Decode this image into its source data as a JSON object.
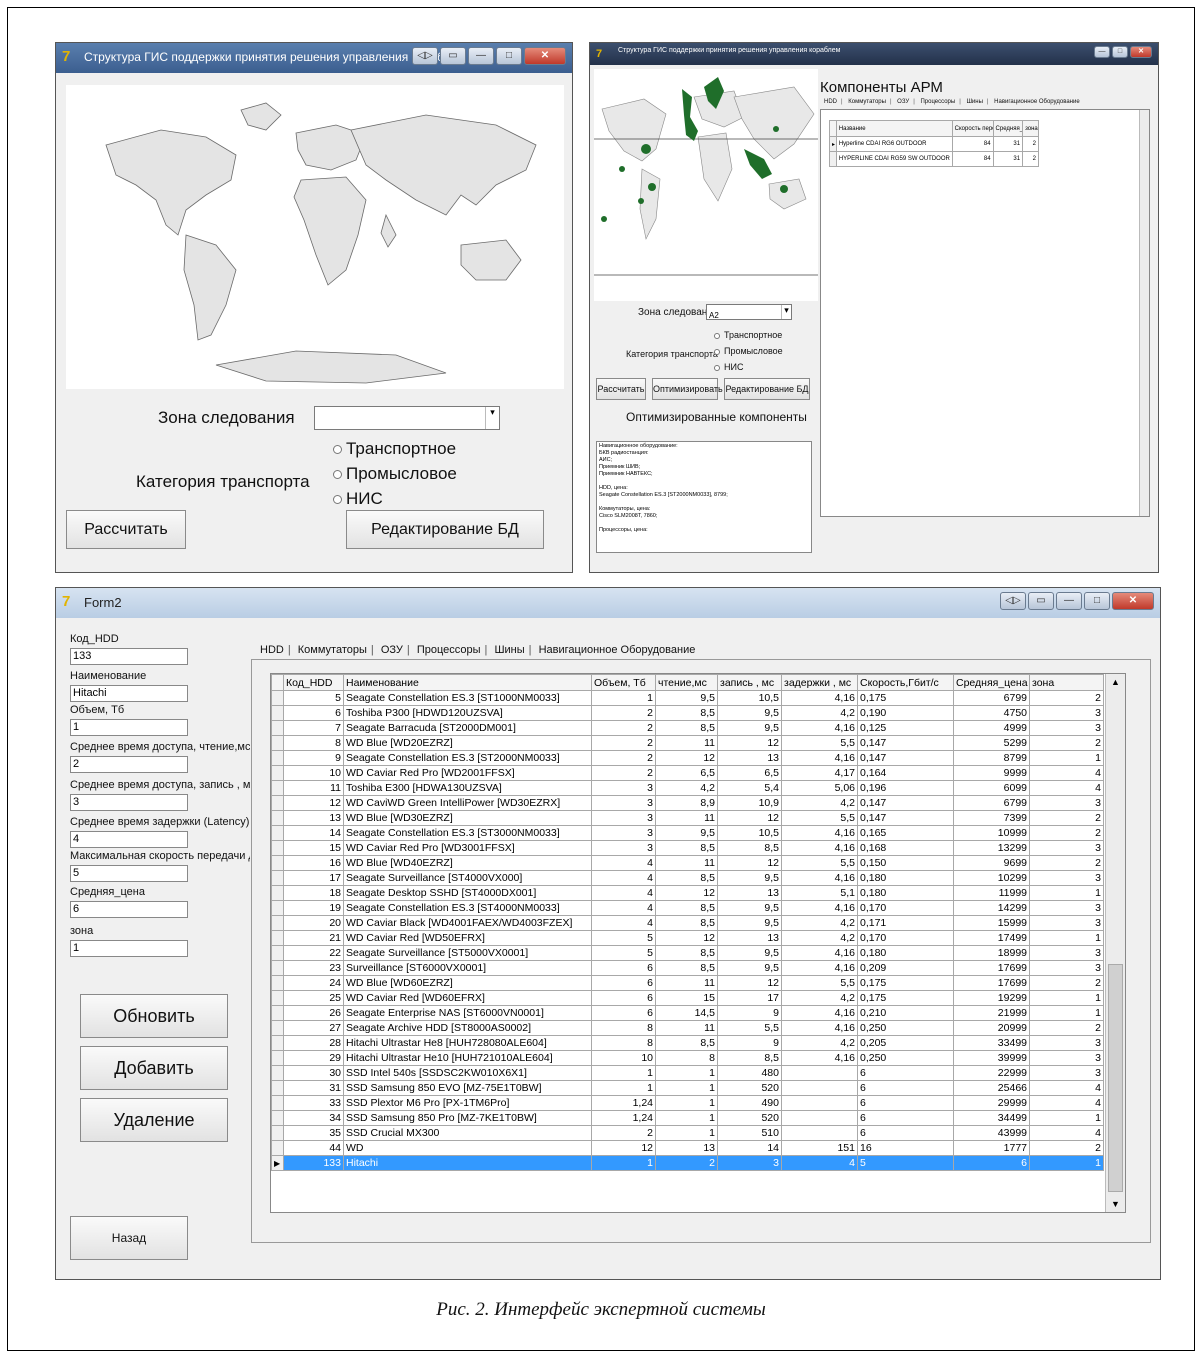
{
  "window1": {
    "title": "Структура ГИС поддержки принятия решения управления кораблем",
    "zone_label": "Зона следования",
    "zone_value": "",
    "category_label": "Категория транспорта",
    "radios": [
      "Транспортное",
      "Промысловое",
      "НИС"
    ],
    "calc_button": "Рассчитать",
    "edit_button": "Редактирование БД"
  },
  "window2": {
    "title": "Структура ГИС поддержки принятия решения управления кораблем",
    "components_title": "Компоненты АРМ",
    "tabs": [
      "HDD",
      "Коммутаторы",
      "ОЗУ",
      "Процессоры",
      "Шины",
      "Навигационное Оборудование"
    ],
    "grid_headers": [
      "Название",
      "Скорость передачи",
      "Средняя_цена",
      "зона"
    ],
    "grid_rows": [
      [
        "Hyperline CDAI RG6 OUTDOOR",
        "84",
        "31",
        "2"
      ],
      [
        "HYPERLINE CDAI RG59 SW OUTDOOR",
        "84",
        "31",
        "2"
      ]
    ],
    "zone_label": "Зона следования",
    "zone_value": "A2",
    "category_label": "Категория транспорта",
    "radios": [
      "Транспортное",
      "Промысловое",
      "НИС"
    ],
    "calc_button": "Рассчитать",
    "optimize_button": "Оптимизировать",
    "edit_button": "Редактирование БД",
    "optimized_title": "Оптимизированные компоненты",
    "optimized_text": [
      "Навигационное оборудование:",
      "БКВ радиостанция:",
      "АИС;",
      "Приемник ШИВ;",
      "Приемник НАВТЕКС;",
      "",
      "HDD, цена:",
      "Seagate Constellation ES.3 [ST2000NM0033], 8799;",
      "",
      "Коммутаторы, цена:",
      "Cisco SLM2008T, 7860;",
      "",
      "Процессоры, цена:"
    ]
  },
  "form2": {
    "title": "Form2",
    "fields": [
      {
        "label": "Код_HDD",
        "value": "133"
      },
      {
        "label": "Наименование",
        "value": "Hitachi"
      },
      {
        "label": "Объем, Тб",
        "value": "1"
      },
      {
        "label": "Среднее время доступа, чтение,мс",
        "value": "2"
      },
      {
        "label": "Среднее время доступа, запись , мс",
        "value": "3"
      },
      {
        "label": "Среднее время задержки (Latency),",
        "value": "4"
      },
      {
        "label": "Максимальная скорость передачи д",
        "value": "5"
      },
      {
        "label": "Средняя_цена",
        "value": "6"
      },
      {
        "label": "зона",
        "value": "1"
      }
    ],
    "update_button": "Обновить",
    "add_button": "Добавить",
    "delete_button": "Удаление",
    "back_button": "Назад",
    "tabs": [
      "HDD",
      "Коммутаторы",
      "ОЗУ",
      "Процессоры",
      "Шины",
      "Навигационное Оборудование"
    ],
    "headers": [
      "Код_HDD",
      "Наименование",
      "Объем, Тб",
      "чтение,мс",
      "запись , мс",
      "задержки , мс",
      "Скорость,Гбит/с",
      "Средняя_цена",
      "зона"
    ],
    "rows": [
      [
        "5",
        "Seagate Constellation ES.3 [ST1000NM0033]",
        "1",
        "9,5",
        "10,5",
        "4,16",
        "0,175",
        "6799",
        "2"
      ],
      [
        "6",
        "Toshiba P300 [HDWD120UZSVA]",
        "2",
        "8,5",
        "9,5",
        "4,2",
        "0,190",
        "4750",
        "3"
      ],
      [
        "7",
        "Seagate Barracuda [ST2000DM001]",
        "2",
        "8,5",
        "9,5",
        "4,16",
        "0,125",
        "4999",
        "3"
      ],
      [
        "8",
        "WD Blue [WD20EZRZ]",
        "2",
        "11",
        "12",
        "5,5",
        "0,147",
        "5299",
        "2"
      ],
      [
        "9",
        "Seagate Constellation ES.3 [ST2000NM0033]",
        "2",
        "12",
        "13",
        "4,16",
        "0,147",
        "8799",
        "1"
      ],
      [
        "10",
        "WD Caviar Red Pro [WD2001FFSX]",
        "2",
        "6,5",
        "6,5",
        "4,17",
        "0,164",
        "9999",
        "4"
      ],
      [
        "11",
        "Toshiba E300 [HDWA130UZSVA]",
        "3",
        "4,2",
        "5,4",
        "5,06",
        "0,196",
        "6099",
        "4"
      ],
      [
        "12",
        "WD CaviWD Green IntelliPower [WD30EZRX]",
        "3",
        "8,9",
        "10,9",
        "4,2",
        "0,147",
        "6799",
        "3"
      ],
      [
        "13",
        "WD Blue [WD30EZRZ]",
        "3",
        "11",
        "12",
        "5,5",
        "0,147",
        "7399",
        "2"
      ],
      [
        "14",
        "Seagate Constellation ES.3 [ST3000NM0033]",
        "3",
        "9,5",
        "10,5",
        "4,16",
        "0,165",
        "10999",
        "2"
      ],
      [
        "15",
        "WD Caviar Red Pro [WD3001FFSX]",
        "3",
        "8,5",
        "8,5",
        "4,16",
        "0,168",
        "13299",
        "3"
      ],
      [
        "16",
        "WD Blue [WD40EZRZ]",
        "4",
        "11",
        "12",
        "5,5",
        "0,150",
        "9699",
        "2"
      ],
      [
        "17",
        "Seagate Surveillance [ST4000VX000]",
        "4",
        "8,5",
        "9,5",
        "4,16",
        "0,180",
        "10299",
        "3"
      ],
      [
        "18",
        "Seagate Desktop SSHD [ST4000DX001]",
        "4",
        "12",
        "13",
        "5,1",
        "0,180",
        "11999",
        "1"
      ],
      [
        "19",
        "Seagate Constellation ES.3 [ST4000NM0033]",
        "4",
        "8,5",
        "9,5",
        "4,16",
        "0,170",
        "14299",
        "3"
      ],
      [
        "20",
        "WD Caviar Black [WD4001FAEX/WD4003FZEX]",
        "4",
        "8,5",
        "9,5",
        "4,2",
        "0,171",
        "15999",
        "3"
      ],
      [
        "21",
        "WD Caviar Red [WD50EFRX]",
        "5",
        "12",
        "13",
        "4,2",
        "0,170",
        "17499",
        "1"
      ],
      [
        "22",
        "Seagate Surveillance [ST5000VX0001]",
        "5",
        "8,5",
        "9,5",
        "4,16",
        "0,180",
        "18999",
        "3"
      ],
      [
        "23",
        "Surveillance [ST6000VX0001]",
        "6",
        "8,5",
        "9,5",
        "4,16",
        "0,209",
        "17699",
        "3"
      ],
      [
        "24",
        "WD Blue [WD60EZRZ]",
        "6",
        "11",
        "12",
        "5,5",
        "0,175",
        "17699",
        "2"
      ],
      [
        "25",
        "WD Caviar Red [WD60EFRX]",
        "6",
        "15",
        "17",
        "4,2",
        "0,175",
        "19299",
        "1"
      ],
      [
        "26",
        "Seagate Enterprise NAS [ST6000VN0001]",
        "6",
        "14,5",
        "9",
        "4,16",
        "0,210",
        "21999",
        "1"
      ],
      [
        "27",
        "Seagate Archive HDD [ST8000AS0002]",
        "8",
        "11",
        "5,5",
        "4,16",
        "0,250",
        "20999",
        "2"
      ],
      [
        "28",
        "Hitachi Ultrastar He8 [HUH728080ALE604]",
        "8",
        "8,5",
        "9",
        "4,2",
        "0,205",
        "33499",
        "3"
      ],
      [
        "29",
        " Hitachi Ultrastar He10 [HUH721010ALE604]",
        "10",
        "8",
        "8,5",
        "4,16",
        "0,250",
        "39999",
        "3"
      ],
      [
        "30",
        "SSD Intel 540s [SSDSC2KW010X6X1]",
        "1",
        "1",
        "480",
        "",
        "6",
        "22999",
        "3"
      ],
      [
        "31",
        "SSD Samsung 850 EVO [MZ-75E1T0BW]",
        "1",
        "1",
        "520",
        "",
        "6",
        "25466",
        "4"
      ],
      [
        "33",
        "SSD Plextor M6 Pro [PX-1TM6Pro]",
        "1,24",
        "1",
        "490",
        "",
        "6",
        "29999",
        "4"
      ],
      [
        "34",
        "SSD Samsung 850 Pro [MZ-7KE1T0BW]",
        "1,24",
        "1",
        "520",
        "",
        "6",
        "34499",
        "1"
      ],
      [
        "35",
        "SSD Crucial MX300",
        "2",
        "1",
        "510",
        "",
        "6",
        "43999",
        "4"
      ],
      [
        "44",
        "WD",
        "12",
        "13",
        "14",
        "151",
        "16",
        "1777",
        "2"
      ],
      [
        "133",
        "Hitachi",
        "1",
        "2",
        "3",
        "4",
        "5",
        "6",
        "1"
      ]
    ],
    "selected_row": 31
  },
  "caption": "Рис. 2. Интерфейс экспертной системы",
  "colors": {
    "selection": "#3399ff",
    "map_land": "#e4e4e4",
    "route_green": "#1f6e2a"
  }
}
